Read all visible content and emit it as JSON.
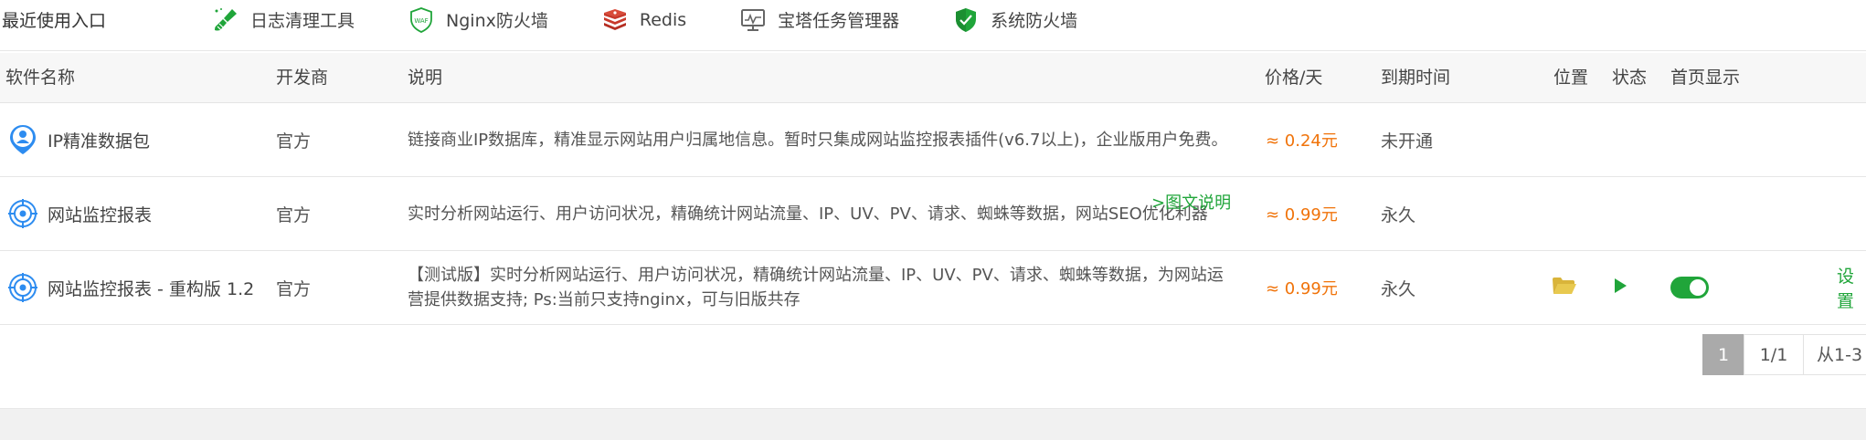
{
  "recent": {
    "label": "最近使用入口",
    "items": [
      {
        "label": "日志清理工具",
        "icon": "broom-icon"
      },
      {
        "label": "Nginx防火墙",
        "icon": "waf-shield-icon",
        "badge": "WAF"
      },
      {
        "label": "Redis",
        "icon": "redis-icon"
      },
      {
        "label": "宝塔任务管理器",
        "icon": "task-manager-icon"
      },
      {
        "label": "系统防火墙",
        "icon": "firewall-shield-icon"
      }
    ]
  },
  "table": {
    "headers": {
      "name": "软件名称",
      "developer": "开发商",
      "description": "说明",
      "price": "价格/天",
      "expire": "到期时间",
      "location": "位置",
      "status": "状态",
      "homepage": "首页显示"
    },
    "rows": [
      {
        "name": "IP精准数据包",
        "icon": "location-user-icon",
        "developer": "官方",
        "description": "链接商业IP数据库，精准显示网站用户归属地信息。暂时只集成网站监控报表插件(v6.7以上)，企业版用户免费。",
        "more": "",
        "price": "≈ 0.24元",
        "expire": "未开通",
        "setting": ""
      },
      {
        "name": "网站监控报表",
        "icon": "radar-target-icon",
        "developer": "官方",
        "description": "实时分析网站运行、用户访问状况，精确统计网站流量、IP、UV、PV、请求、蜘蛛等数据，网站SEO优化利器",
        "more": ">图文说明",
        "price": "≈ 0.99元",
        "expire": "永久",
        "setting": ""
      },
      {
        "name": "网站监控报表 - 重构版 1.2",
        "icon": "radar-target-icon",
        "developer": "官方",
        "description": "【测试版】实时分析网站运行、用户访问状况，精确统计网站流量、IP、UV、PV、请求、蜘蛛等数据，为网站运营提供数据支持; Ps:当前只支持nginx，可与旧版共存",
        "more": "",
        "price": "≈ 0.99元",
        "expire": "永久",
        "setting": "设置"
      }
    ]
  },
  "pagination": {
    "current": "1",
    "total": "1/1",
    "range": "从1-3"
  },
  "colors": {
    "accent_green": "#20a53a",
    "price_orange": "#f0730a",
    "folder_yellow": "#e8c94f",
    "header_bg": "#f7f7f7"
  }
}
